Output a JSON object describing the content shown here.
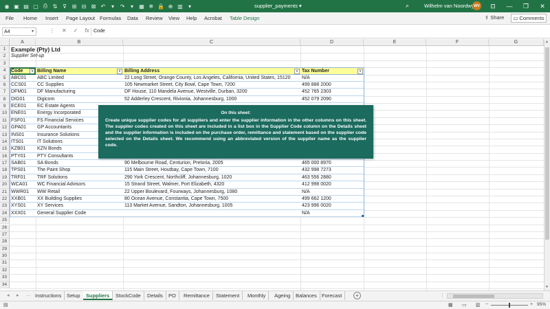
{
  "window": {
    "file_name": "supplier_payments",
    "file_dropdown": "▾",
    "user_name": "Wilhelm van Noordwyk",
    "user_initials": "WV"
  },
  "ribbon": {
    "tabs": [
      "File",
      "Home",
      "Insert",
      "Page Layout",
      "Formulas",
      "Data",
      "Review",
      "View",
      "Help",
      "Acrobat",
      "Table Design"
    ],
    "active_tab": "Table Design",
    "share_label": "Share",
    "comments_label": "Comments"
  },
  "formula_bar": {
    "name_box": "A4",
    "formula": "Code"
  },
  "columns": [
    "A",
    "B",
    "C",
    "D",
    "E",
    "F",
    "G"
  ],
  "sheet": {
    "title": "Example (Pty) Ltd",
    "subtitle": "Supplier Set-up",
    "headers": [
      "Code",
      "Billing Name",
      "Billing Address",
      "Tax Number"
    ],
    "rows": [
      [
        "ABC01",
        "ABC Limited",
        "22 Long Street, Orange County, Los Angeles, California, United States, 15120",
        "N/A"
      ],
      [
        "CCS01",
        "CC Supplies",
        "105 Newmarket Street, City Bowl, Cape Town, 7200",
        "499 888 2000"
      ],
      [
        "DFM01",
        "DF Manufacturing",
        "DF House, 110 Mandela Avenue, Westville, Durban, 3200",
        "452 765 2303"
      ],
      [
        "DIG01",
        "Digicom",
        "52 Adderley Crescent, Rivionia, Johannesburg, 1000",
        "452 079 2090"
      ],
      [
        "ECE01",
        "EC Estate Agents",
        "",
        ""
      ],
      [
        "ENE01",
        "Energy Incorporated",
        "",
        ""
      ],
      [
        "FSF01",
        "FS Financial Services",
        "",
        ""
      ],
      [
        "GPA01",
        "GP Accountants",
        "",
        ""
      ],
      [
        "INS01",
        "Insurance Solutions",
        "",
        ""
      ],
      [
        "ITS01",
        "IT Solutions",
        "",
        ""
      ],
      [
        "KZB01",
        "KZN Bonds",
        "",
        ""
      ],
      [
        "PTY01",
        "PTY Consultants",
        "",
        ""
      ],
      [
        "SAB01",
        "SA Bonds",
        "90 Melbourne Road, Centurion, Pretoria, 2005",
        "465 000 8970"
      ],
      [
        "TPS01",
        "The Paint Shop",
        "115 Main Street, Houtbay, Cape Town, 7100",
        "432 998 7273"
      ],
      [
        "TRF01",
        "TRF Solutions",
        "290 York Crescent, Northcliff, Johannesburg, 1020",
        "463 556 2880"
      ],
      [
        "WCA01",
        "WC Financial Advisors",
        "15 Strand Street, Walmer, Port Elizabeth, 4320",
        "412 998 0020"
      ],
      [
        "WWR01",
        "WW Retail",
        "22 Upper Boulevard, Fourways, Johannesburg, 1080",
        "N/A"
      ],
      [
        "XXB01",
        "XX Building Supplies",
        "80 Ocean Avenue, Constantia, Cape Town, 7500",
        "499 662 1200"
      ],
      [
        "XYS01",
        "XY Services",
        "113 Market Avenue, Sandton, Johannesburg, 1005",
        "423 996 0020"
      ],
      [
        "XXX01",
        "General Supplier Code",
        "",
        "N/A"
      ]
    ]
  },
  "note": {
    "title": "On this sheet:",
    "body": "Create unique supplier codes for all suppliers and enter the supplier information in the other columns on this sheet. The supplier codes created on this sheet are included in a list box in the Supplier Code column on the Details sheet and the supplier information is included on the purchase order, remittance and statement based on the supplier code selected on the Details sheet. We recommend using an abbreviated version of the supplier name as the supplier code."
  },
  "sheet_tabs": [
    "Instructions",
    "Setup",
    "Suppliers",
    "StockCode",
    "Details",
    "PO",
    "Remittance",
    "Statement",
    "Monthly",
    "Ageing",
    "Balances",
    "Forecast"
  ],
  "active_sheet": "Suppliers",
  "status": {
    "zoom": "95%"
  },
  "icons": {
    "save": "save-icon",
    "undo": "undo-icon",
    "redo": "redo-icon",
    "search": "search-icon",
    "fx": "function-icon"
  },
  "colors": {
    "excel_green": "#217346",
    "header_fill": "#ffff99",
    "note_fill": "#1b6b5e",
    "table_border": "#8fb3d6"
  }
}
